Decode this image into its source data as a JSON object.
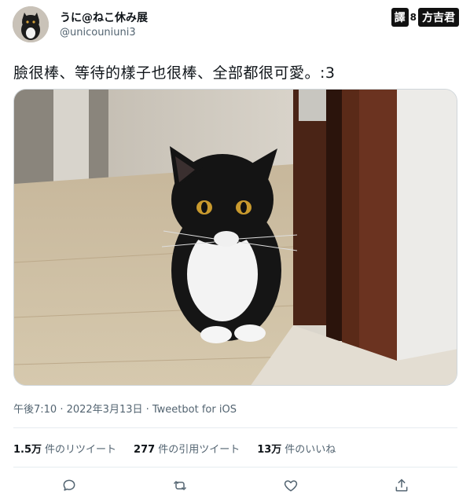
{
  "author": {
    "display_name": "うに@ねこ休み展",
    "handle": "@unicouniuni3"
  },
  "watermark": {
    "badge": "譯",
    "dot": "8",
    "name": "方吉君"
  },
  "tweet": {
    "text": "臉很棒、等待的樣子也很棒、全部都很可愛。:3"
  },
  "meta": {
    "time": "午後7:10 · 2022年3月13日 · ",
    "client": "Tweetbot for iOS"
  },
  "stats": {
    "retweets_count": "1.5万",
    "retweets_label": "件のリツイート",
    "quotes_count": "277",
    "quotes_label": "件の引用ツイート",
    "likes_count": "13万",
    "likes_label": "件のいいね"
  },
  "actions": {
    "icons": [
      "reply-icon",
      "retweet-icon",
      "like-icon",
      "share-icon"
    ]
  },
  "colors": {
    "text": "#0f1419",
    "secondary": "#536471",
    "divider": "#e6ecf0"
  }
}
